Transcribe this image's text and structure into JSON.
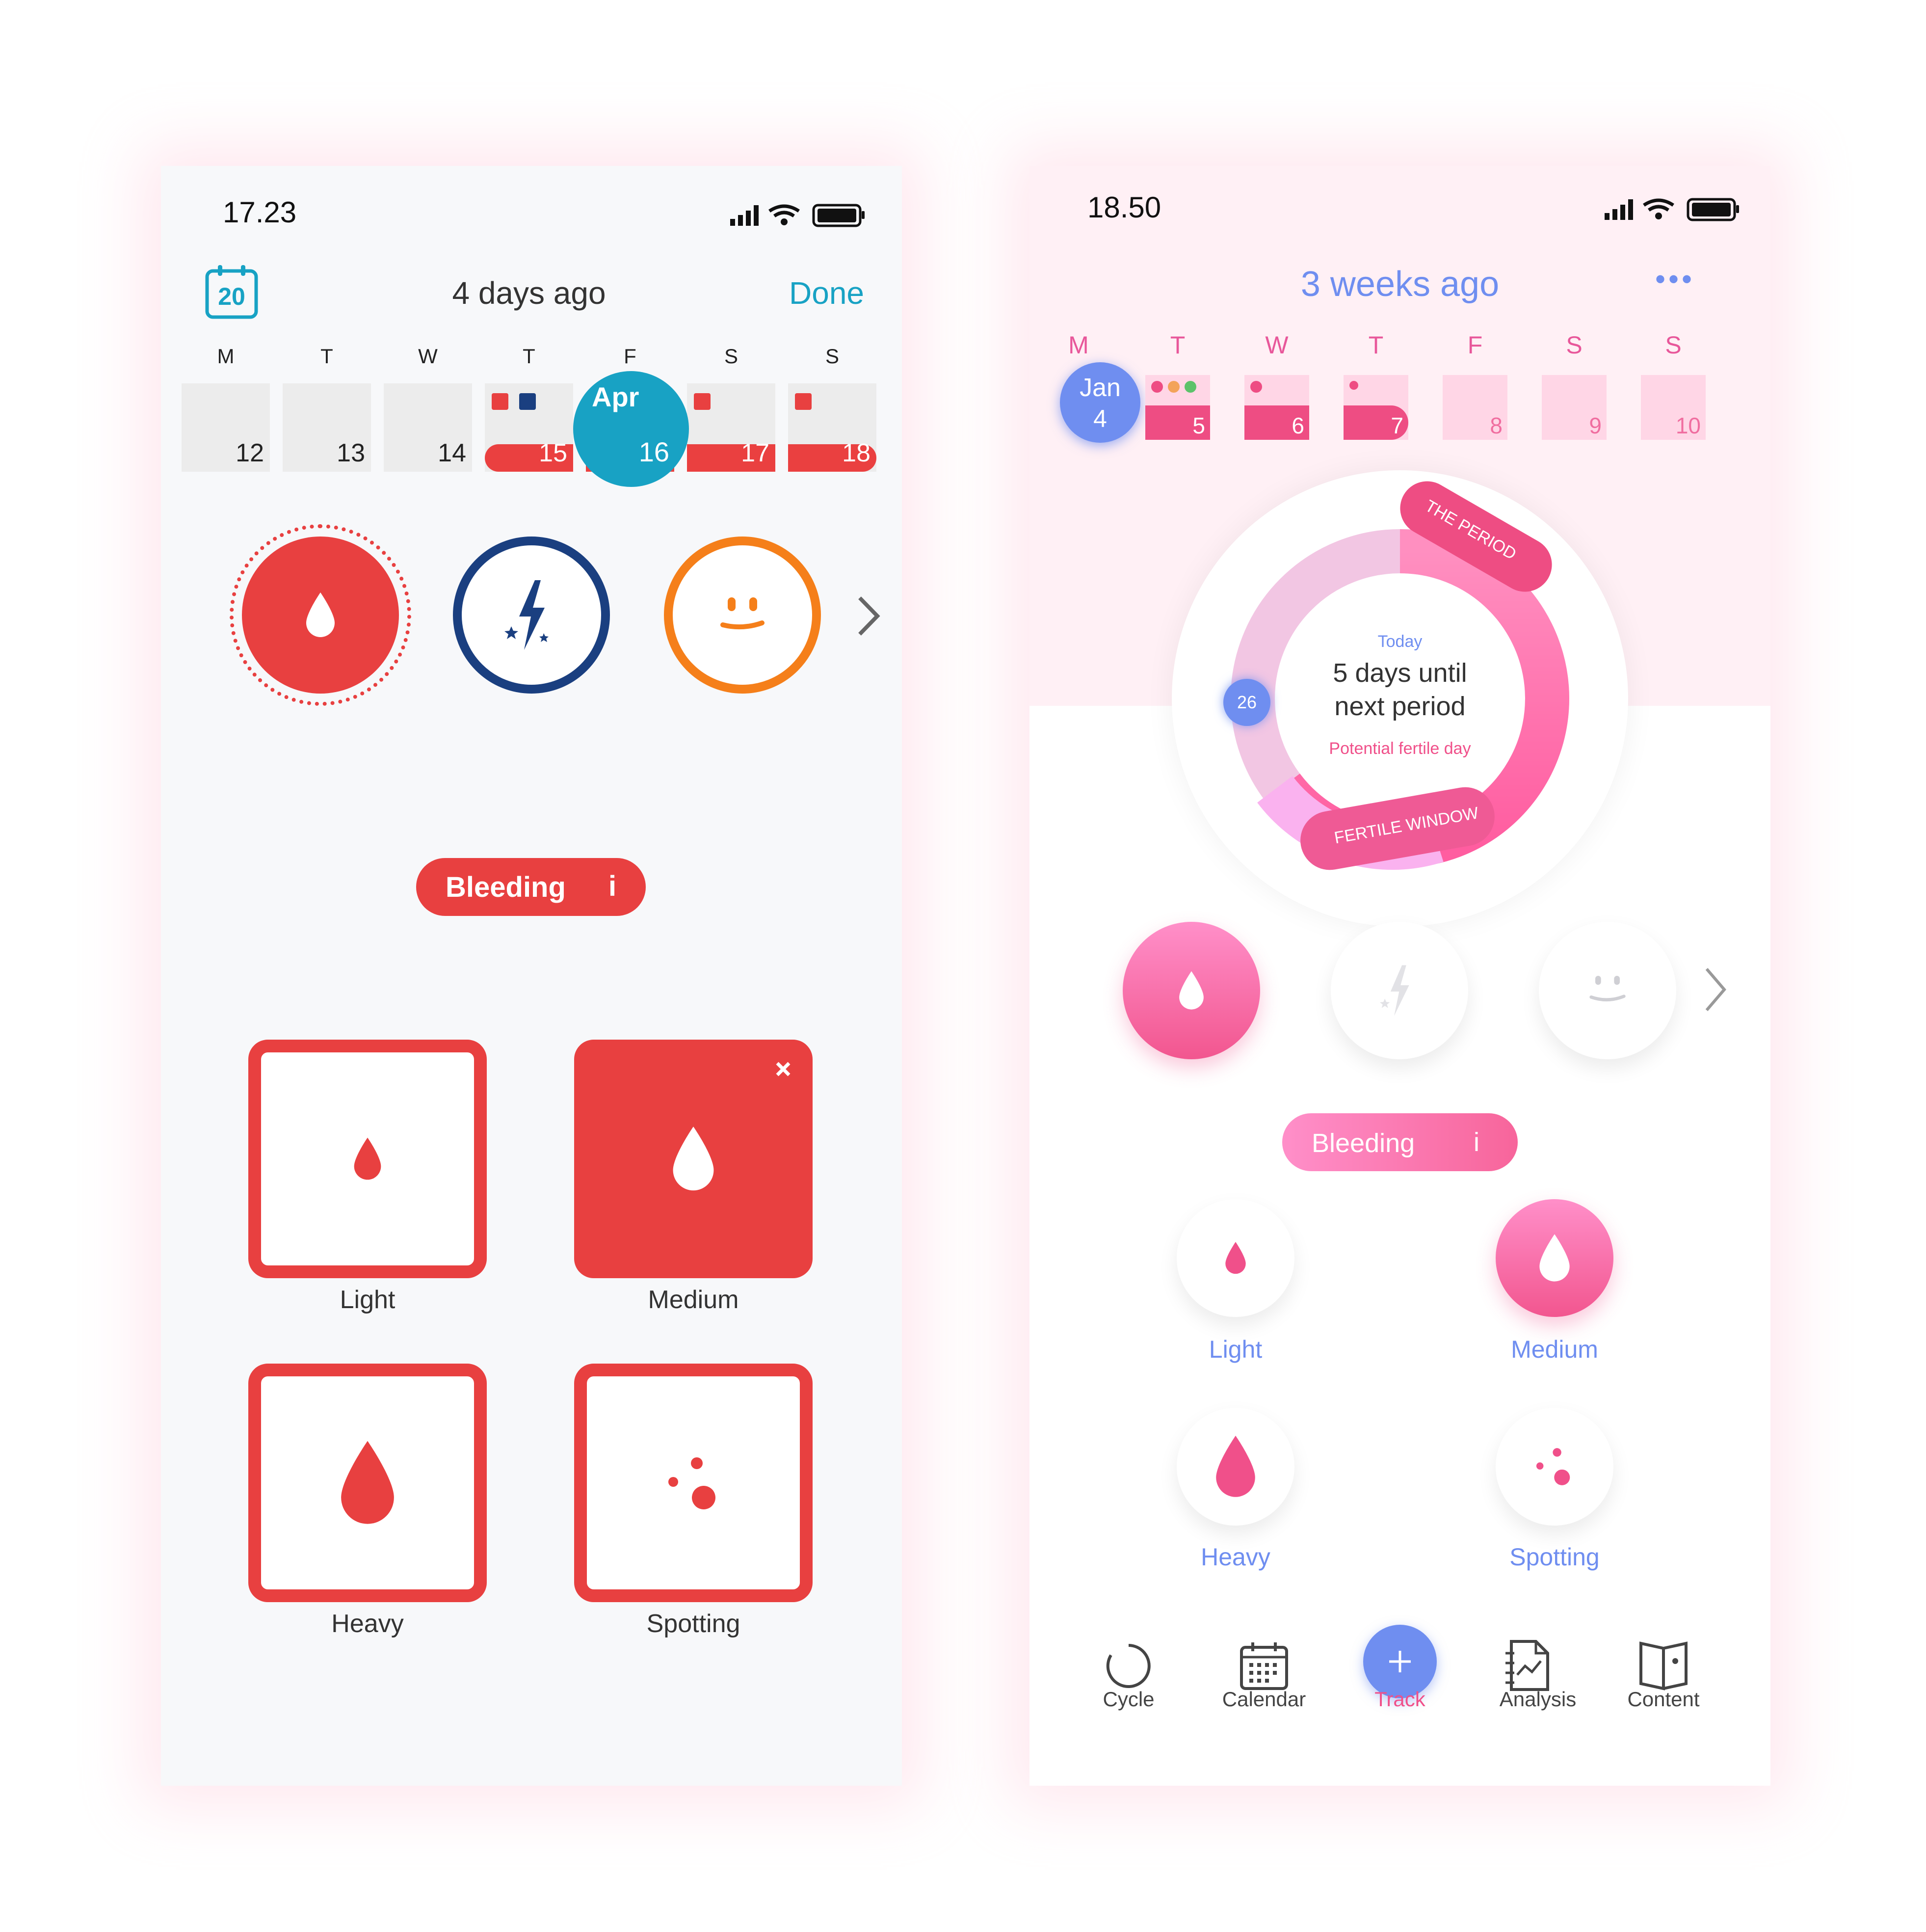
{
  "left": {
    "status": {
      "time": "17.23"
    },
    "header": {
      "calendar_day": "20",
      "title": "4 days ago",
      "done_label": "Done"
    },
    "week": {
      "headers": [
        "M",
        "T",
        "W",
        "T",
        "F",
        "S",
        "S"
      ],
      "days": [
        "12",
        "13",
        "14",
        "15",
        "16",
        "17",
        "18"
      ],
      "selected_month": "Apr"
    },
    "category_pill": {
      "label": "Bleeding",
      "info": "i"
    },
    "options": [
      "Light",
      "Medium",
      "Heavy",
      "Spotting"
    ],
    "colors": {
      "red": "#e84040",
      "blue": "#1a3f80",
      "orange": "#f57f1a",
      "teal": "#18a2c4"
    }
  },
  "right": {
    "status": {
      "time": "18.50"
    },
    "header": {
      "title": "3 weeks ago",
      "more_label": "•••"
    },
    "week": {
      "headers": [
        "M",
        "T",
        "W",
        "T",
        "F",
        "S",
        "S"
      ],
      "selected_month": "Jan",
      "days": [
        "4",
        "5",
        "6",
        "7",
        "8",
        "9",
        "10"
      ]
    },
    "cycle": {
      "today_label": "Today",
      "main_text_1": "5 days until",
      "main_text_2": "next period",
      "sub_text": "Potential fertile day",
      "marker_day": "26",
      "period_label": "THE PERIOD",
      "fertile_label": "FERTILE WINDOW"
    },
    "category_pill": {
      "label": "Bleeding",
      "info": "i"
    },
    "options": [
      "Light",
      "Medium",
      "Heavy",
      "Spotting"
    ],
    "nav": [
      "Cycle",
      "Calendar",
      "Track",
      "Analysis",
      "Content"
    ],
    "colors": {
      "pink": "#f0508a",
      "blue": "#6f8ef0"
    }
  }
}
